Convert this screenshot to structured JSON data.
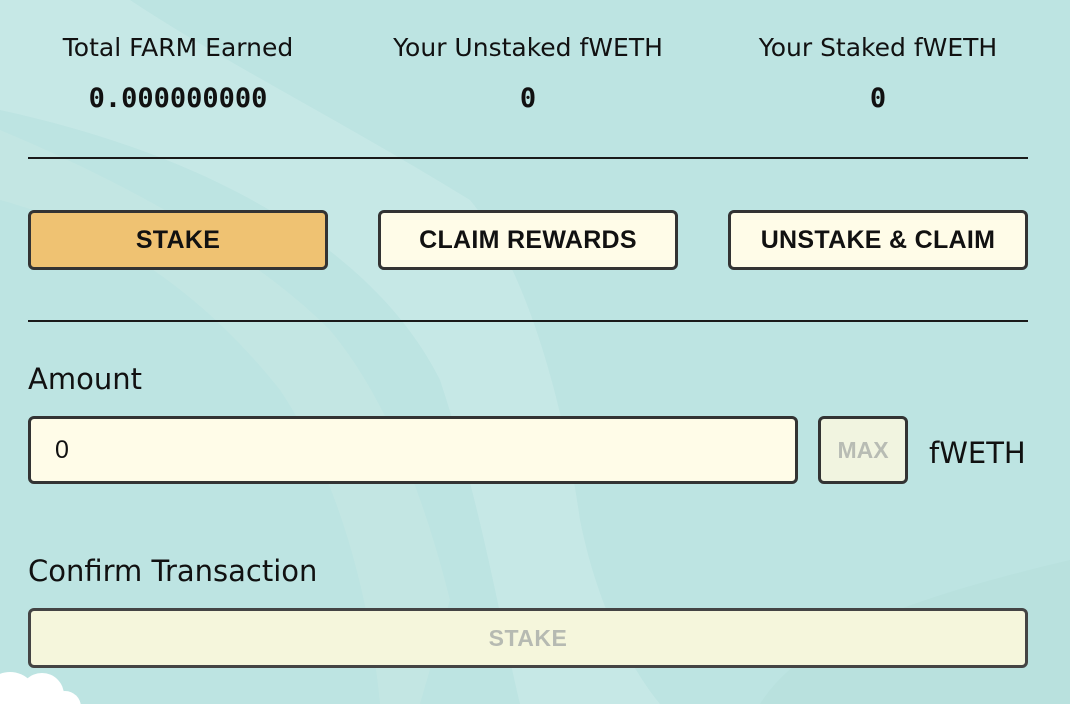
{
  "stats": [
    {
      "label": "Total FARM Earned",
      "value": "0.000000000"
    },
    {
      "label": "Your Unstaked fWETH",
      "value": "0"
    },
    {
      "label": "Your Staked fWETH",
      "value": "0"
    }
  ],
  "actions": {
    "stake_label": "STAKE",
    "claim_label": "CLAIM REWARDS",
    "unstake_label": "UNSTAKE & CLAIM"
  },
  "amount": {
    "label": "Amount",
    "value": "0",
    "max_label": "MAX",
    "token": "fWETH"
  },
  "confirm": {
    "label": "Confirm Transaction",
    "button_label": "STAKE"
  },
  "colors": {
    "background": "#bde4e2",
    "active_button": "#efc272",
    "button": "#fffce8"
  }
}
